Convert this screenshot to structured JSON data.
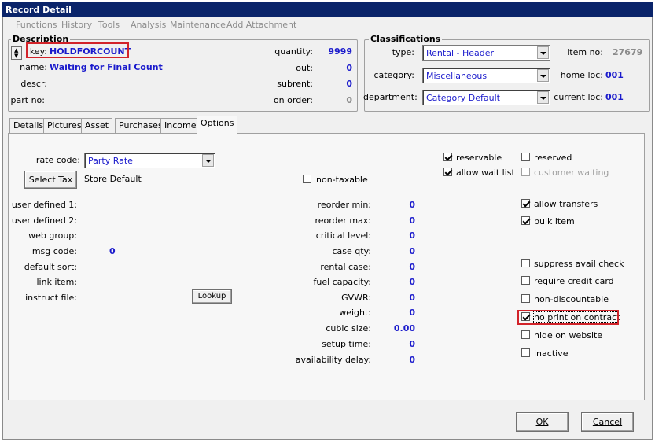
{
  "window": {
    "title": "Record Detail"
  },
  "menu": [
    "Functions",
    "History",
    "Tools",
    "Analysis",
    "Maintenance",
    "Add Attachment"
  ],
  "description": {
    "group_label": "Description",
    "key_label": "key:",
    "key_value": "HOLDFORCOUNT",
    "name_label": "name:",
    "name_value": "Waiting for Final Count",
    "descr_label": "descr:",
    "partno_label": "part no:",
    "quantity_label": "quantity:",
    "quantity_value": "9999",
    "out_label": "out:",
    "out_value": "0",
    "subrent_label": "subrent:",
    "subrent_value": "0",
    "onorder_label": "on order:",
    "onorder_value": "0"
  },
  "classifications": {
    "group_label": "Classifications",
    "type_label": "type:",
    "type_value": "Rental - Header",
    "category_label": "category:",
    "category_value": "Miscellaneous",
    "department_label": "department:",
    "department_value": "Category Default",
    "itemno_label": "item no:",
    "itemno_value": "27679",
    "homeloc_label": "home loc:",
    "homeloc_value": "001",
    "currentloc_label": "current loc:",
    "currentloc_value": "001"
  },
  "tabs": [
    "Details",
    "Pictures",
    "Asset",
    "Purchases",
    "Income",
    "Options"
  ],
  "active_tab": "Options",
  "options": {
    "rate_code_label": "rate code:",
    "rate_code_value": "Party Rate",
    "select_tax_button": "Select Tax",
    "tax_value": "Store Default",
    "non_taxable_label": "non-taxable",
    "left_fields": [
      {
        "label": "user defined 1:",
        "value": ""
      },
      {
        "label": "user defined 2:",
        "value": ""
      },
      {
        "label": "web group:",
        "value": ""
      },
      {
        "label": "msg code:",
        "value": "0"
      },
      {
        "label": "default sort:",
        "value": ""
      },
      {
        "label": "link item:",
        "value": ""
      },
      {
        "label": "instruct file:",
        "value": ""
      }
    ],
    "lookup_button": "Lookup",
    "mid_fields": [
      {
        "label": "reorder min:",
        "value": "0"
      },
      {
        "label": "reorder max:",
        "value": "0"
      },
      {
        "label": "critical level:",
        "value": "0"
      },
      {
        "label": "case qty:",
        "value": "0"
      },
      {
        "label": "rental case:",
        "value": "0"
      },
      {
        "label": "fuel capacity:",
        "value": "0"
      },
      {
        "label": "GVWR:",
        "value": "0"
      },
      {
        "label": "weight:",
        "value": "0"
      },
      {
        "label": "cubic size:",
        "value": "0.00"
      },
      {
        "label": "setup time:",
        "value": "0"
      },
      {
        "label": "availability delay:",
        "value": "0"
      }
    ],
    "checkboxes": {
      "reservable": {
        "label": "reservable",
        "checked": true
      },
      "allow_wait_list": {
        "label": "allow wait list",
        "checked": true
      },
      "reserved": {
        "label": "reserved",
        "checked": false
      },
      "customer_waiting": {
        "label": "customer waiting",
        "checked": false
      },
      "allow_transfers": {
        "label": "allow transfers",
        "checked": true
      },
      "bulk_item": {
        "label": "bulk item",
        "checked": true
      },
      "suppress_avail_check": {
        "label": "suppress avail check",
        "checked": false
      },
      "require_credit_card": {
        "label": "require credit card",
        "checked": false
      },
      "non_discountable": {
        "label": "non-discountable",
        "checked": false
      },
      "no_print_on_contract": {
        "label": "no print on contract",
        "checked": true
      },
      "hide_on_website": {
        "label": "hide on website",
        "checked": false
      },
      "inactive": {
        "label": "inactive",
        "checked": false
      }
    }
  },
  "footer": {
    "ok": "OK",
    "cancel": "Cancel"
  },
  "colors": {
    "title_bar": "#0a246a",
    "value_blue": "#1a1acc",
    "highlight_red": "#d2232a"
  }
}
